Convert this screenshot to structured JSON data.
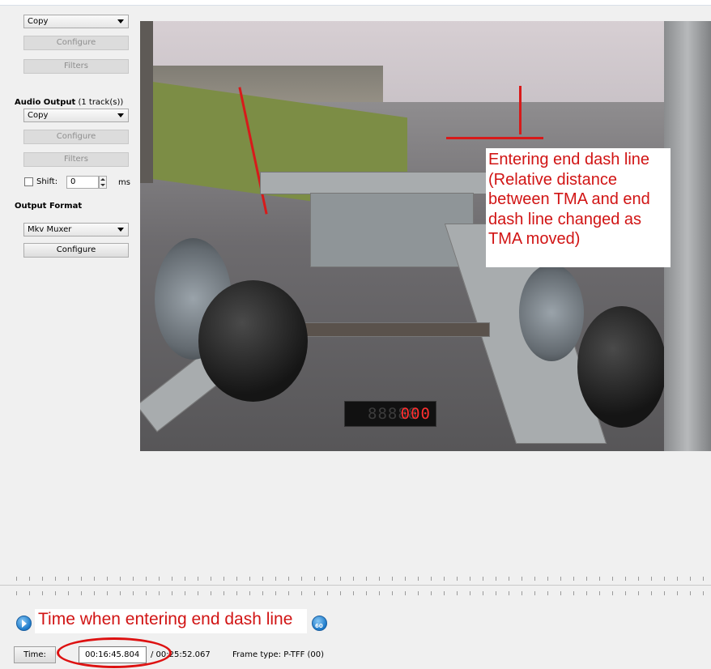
{
  "video_panel": {
    "codec_value": "Copy",
    "configure_label": "Configure",
    "filters_label": "Filters"
  },
  "audio_panel": {
    "heading": "Audio Output",
    "track_count": "(1 track(s))",
    "codec_value": "Copy",
    "configure_label": "Configure",
    "filters_label": "Filters",
    "shift_label": "Shift:",
    "shift_value": "0",
    "shift_unit": "ms",
    "shift_checked": false
  },
  "output_panel": {
    "heading": "Output Format",
    "format_value": "Mkv Muxer",
    "configure_label": "Configure"
  },
  "video_annotation": {
    "text": "Entering end dash line (Relative distance between TMA and end dash line changed as TMA moved)",
    "color": "#d11414"
  },
  "counter_display": {
    "dim_digits": "88888",
    "lit_digits": "000"
  },
  "time_annotation": {
    "text": "Time when entering end dash line"
  },
  "status_bar": {
    "time_button_label": "Time:",
    "current_time": "00:16:45.804",
    "total_time": "/ 00:25:52.067",
    "frame_type": "Frame type:  P-TFF (00)"
  },
  "icons": {
    "prev_nav": "play-circle-icon",
    "next_nav": "go-to-icon"
  }
}
